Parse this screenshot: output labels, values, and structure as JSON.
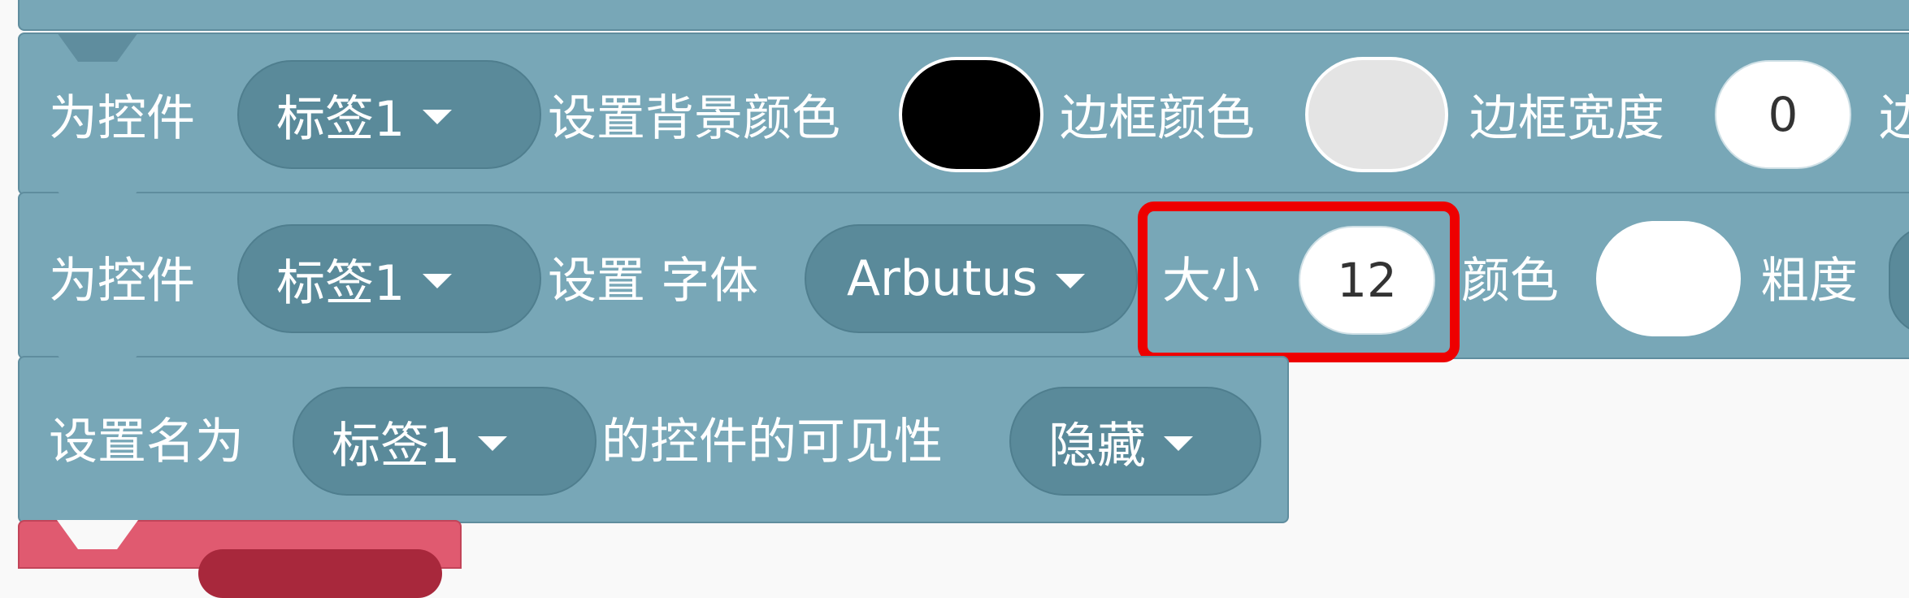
{
  "block1": {
    "prefix": "为控件",
    "component": "标签1",
    "bg_label": "设置背景颜色",
    "bg_color": "#000000",
    "border_color_label": "边框颜色",
    "border_color": "#e4e4e4",
    "border_width_label": "边框宽度",
    "border_width": "0",
    "next_label": "边"
  },
  "block2": {
    "prefix": "为控件",
    "component": "标签1",
    "font_label": "设置 字体",
    "font": "Arbutus",
    "size_label": "大小",
    "size": "12",
    "color_label": "颜色",
    "color": "#ffffff",
    "weight_label": "粗度"
  },
  "block3": {
    "prefix": "设置名为",
    "component": "标签1",
    "visibility_label": "的控件的可见性",
    "visibility": "隐藏"
  },
  "accent": {
    "block_color": "#78a7b7",
    "next_block_color": "#e05a70",
    "highlight_color": "#ee0000"
  }
}
